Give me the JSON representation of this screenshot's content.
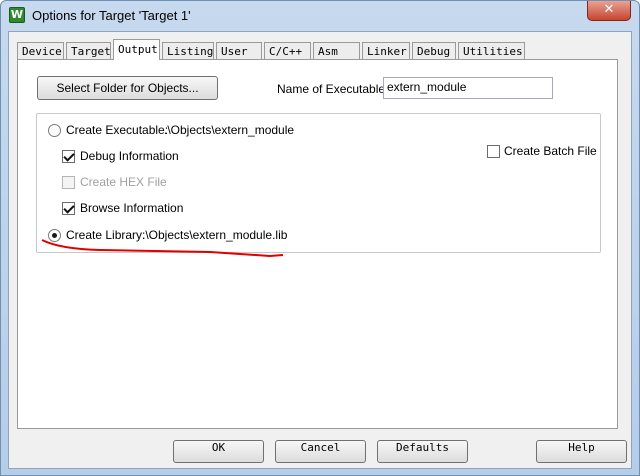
{
  "window": {
    "title": "Options for Target 'Target 1'",
    "app_icon": "W",
    "close_glyph": "✕"
  },
  "tabs": [
    {
      "label": "Device"
    },
    {
      "label": "Target"
    },
    {
      "label": "Output"
    },
    {
      "label": "Listing"
    },
    {
      "label": "User"
    },
    {
      "label": "C/C++"
    },
    {
      "label": "Asm"
    },
    {
      "label": "Linker"
    },
    {
      "label": "Debug"
    },
    {
      "label": "Utilities"
    }
  ],
  "active_tab": "Output",
  "output": {
    "select_folder_button": "Select Folder for Objects...",
    "name_label": "Name of Executable:",
    "name_value": "extern_module",
    "create_executable": {
      "label": "Create Executable:",
      "path": ".\\Objects\\extern_module",
      "selected": false
    },
    "debug_info": {
      "label": "Debug Information",
      "checked": true
    },
    "create_hex": {
      "label": "Create HEX File",
      "checked": false,
      "enabled": false
    },
    "browse_info": {
      "label": "Browse Information",
      "checked": true
    },
    "create_library": {
      "label": "Create Library:",
      "path": ".\\Objects\\extern_module.lib",
      "selected": true
    },
    "create_batch": {
      "label": "Create Batch File",
      "checked": false
    }
  },
  "buttons": {
    "ok": "OK",
    "cancel": "Cancel",
    "defaults": "Defaults",
    "help": "Help"
  },
  "colors": {
    "annotation": "#e00000",
    "titlebar": "#c6d9ee",
    "close_button": "#c7452f"
  }
}
